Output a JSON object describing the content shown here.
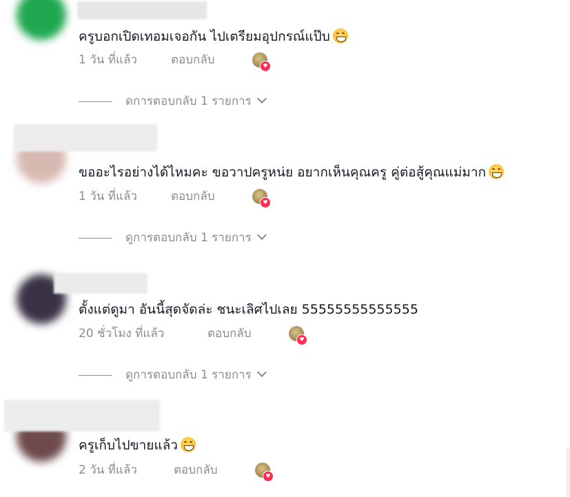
{
  "colors": {
    "text": "#161823",
    "meta": "#8a8b91",
    "like_heart": "#fe2c55"
  },
  "comments": [
    {
      "avatar_color": "#1fa84f",
      "text": "ครูบอกเปิดเทอมเจอกัน ไปเตรียมอุปกรณ์แป๊บ",
      "emoji": "grinning-face-icon",
      "time": "1 วัน ที่แล้ว",
      "reply": "ตอบกลับ",
      "view_replies": "ดการตอบกลับ 1 รายการ"
    },
    {
      "avatar_color": "#d8b9b2",
      "text": "ขออะไรอย่างได้ไหมคะ ขอวาปครูหน่ย อยากเห็นคุณครู คู่ต่อสู้คุณแม่มาก",
      "emoji": "tears-of-joy-icon",
      "time": "1 วัน ที่แล้ว",
      "reply": "ตอบกลับ",
      "view_replies": "ดูการตอบกลับ 1 รายการ"
    },
    {
      "avatar_color": "#3a3346",
      "text": "ตั้งแต่ดูมา อันนี้สุดจัดล่ะ ชนะเลิศไปเลย 55555555555555",
      "emoji": "",
      "time": "20 ชั่วโมง ที่แล้ว",
      "reply": "ตอบกลับ",
      "view_replies": "ดูการตอบกลับ 1 รายการ"
    },
    {
      "avatar_color": "#6e4a4d",
      "text": "ครูเก็บไปขายแล้ว",
      "emoji": "tears-of-joy-icon",
      "time": "2 วัน ที่แล้ว",
      "reply": "ตอบกลับ",
      "view_replies": ""
    }
  ]
}
